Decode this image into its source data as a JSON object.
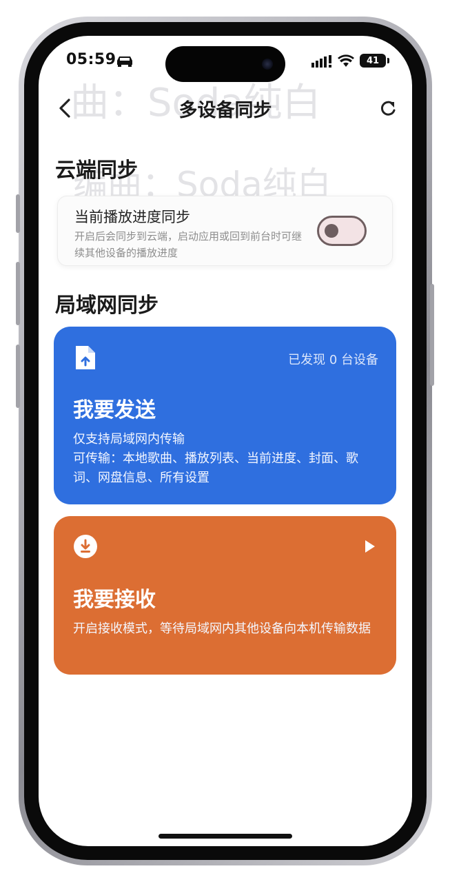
{
  "status_bar": {
    "time": "05:59",
    "battery_level": "41",
    "icons": [
      "car-icon",
      "signal-icon",
      "wifi-icon",
      "battery-icon"
    ]
  },
  "background_text": {
    "line1": "曲：Soda纯白",
    "line2": "编曲：Soda纯白"
  },
  "nav": {
    "title": "多设备同步",
    "back_icon": "chevron-left-icon",
    "refresh_icon": "refresh-icon"
  },
  "cloud_sync": {
    "section_title": "云端同步",
    "item_title": "当前播放进度同步",
    "item_desc": "开启后会同步到云端，启动应用或回到前台时可继续其他设备的播放进度",
    "toggle_on": false
  },
  "lan_sync": {
    "section_title": "局域网同步",
    "send": {
      "icon": "file-upload-icon",
      "status": "已发现 0 台设备",
      "title": "我要发送",
      "desc": "仅支持局域网内传输\n可传输：本地歌曲、播放列表、当前进度、封面、歌词、网盘信息、所有设置",
      "color": "#2f6fdf"
    },
    "receive": {
      "icon": "download-circle-icon",
      "arrow_icon": "play-arrow-icon",
      "title": "我要接收",
      "desc": "开启接收模式，等待局域网内其他设备向本机传输数据",
      "color": "#dc6e33"
    }
  }
}
